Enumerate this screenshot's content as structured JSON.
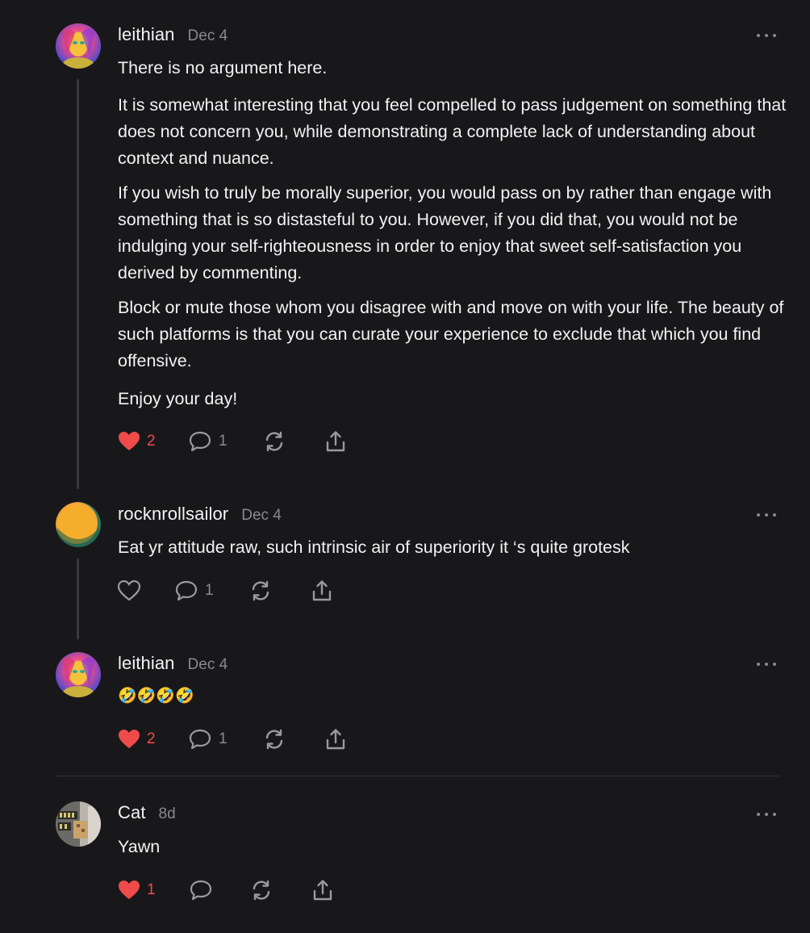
{
  "comments": [
    {
      "username": "leithian",
      "date": "Dec 4",
      "paragraphs": [
        "There is no argument here.",
        "It is somewhat interesting that you feel compelled to pass judgement on something that does not concern you, while demonstrating a complete lack of understanding about context and nuance.",
        "If you wish to truly be morally superior, you would pass on by rather than engage with something that is so distasteful to you. However, if you did that, you would not be indulging your self-righteousness in order to enjoy that sweet self-satisfaction you derived by commenting.",
        "Block or mute those whom you disagree with and move on with your life. The beauty of such platforms is that you can curate your experience to exclude that which you find offensive.",
        "Enjoy your day!"
      ],
      "likes": "2",
      "liked": true,
      "replies": "1"
    },
    {
      "username": "rocknrollsailor",
      "date": "Dec 4",
      "paragraphs": [
        "Eat yr attitude raw, such intrinsic air of superiority it ‘s quite grotesk"
      ],
      "likes": "",
      "liked": false,
      "replies": "1"
    },
    {
      "username": "leithian",
      "date": "Dec 4",
      "paragraphs": [
        "🤣🤣🤣🤣"
      ],
      "likes": "2",
      "liked": true,
      "replies": "1"
    },
    {
      "username": "Cat",
      "date": "8d",
      "paragraphs": [
        "Yawn"
      ],
      "likes": "1",
      "liked": true,
      "replies": ""
    }
  ],
  "icons": {
    "like": "heart-icon",
    "reply": "comment-bubble-icon",
    "restack": "restack-icon",
    "share": "share-icon",
    "more": "more-options-icon"
  },
  "colors": {
    "background": "#18181a",
    "liked": "#ef4b4b",
    "muted": "#8a8a8e",
    "text": "#f2f2f2"
  }
}
